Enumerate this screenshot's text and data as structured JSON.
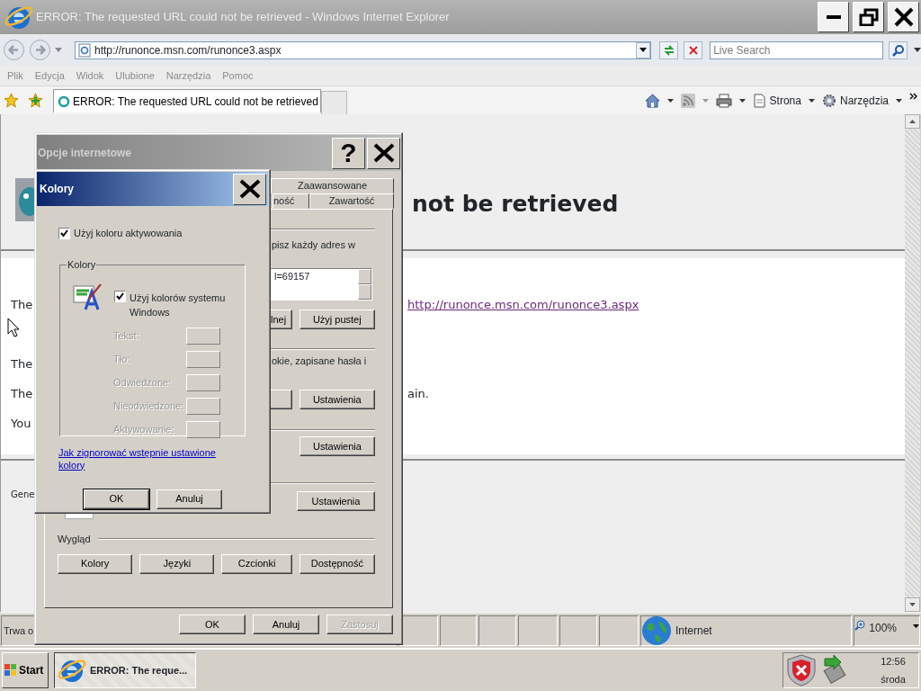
{
  "browser": {
    "title": "ERROR: The requested URL could not be retrieved - Windows Internet Explorer",
    "address": "http://runonce.msn.com/runonce3.aspx",
    "search_placeholder": "Live Search",
    "menu": [
      "Plik",
      "Edycja",
      "Widok",
      "Ulubione",
      "Narzędzia",
      "Pomoc"
    ],
    "tabs": [
      {
        "label": "ERROR: The requested URL could not be retrieved",
        "selected": true
      }
    ],
    "commands": [
      {
        "kind": "page",
        "label": "Strona"
      },
      {
        "kind": "tools",
        "label": "Narzędzia"
      }
    ]
  },
  "page": {
    "heading": "not be retrieved",
    "rows": [
      {
        "left": "The",
        "right": "http://runonce.msn.com/runonce3.aspx",
        "kind": "link"
      },
      {
        "left": "The"
      },
      {
        "left": "The",
        "right": "ain.",
        "kind": "text"
      },
      {
        "left": "You"
      }
    ],
    "footer": "Gene"
  },
  "status_bar": {
    "text": "Trwa o",
    "zone": "Internet",
    "zoom": "100%"
  },
  "options_dialog": {
    "title": "Opcje internetowe",
    "help": "?",
    "tab_rows": [
      [
        {
          "label": "Zaawansowane",
          "selected": false
        }
      ],
      [
        {
          "label": "ność",
          "selected": false
        },
        {
          "label": "Zawartość",
          "selected": false
        }
      ]
    ],
    "home": {
      "text": "pisz każdy adres w",
      "value": "l=69157",
      "buttons": [
        "lnej",
        "Użyj pustej"
      ]
    },
    "history": {
      "text": "okie, zapisane hasła i",
      "buttons": [
        "Ustawienia"
      ]
    },
    "search": {
      "buttons": [
        "Ustawienia"
      ]
    },
    "tabs_section": {
      "buttons": [
        "Ustawienia"
      ]
    },
    "appearance": {
      "label": "Wygląd",
      "buttons": [
        "Kolory",
        "Języki",
        "Czcionki",
        "Dostępność"
      ]
    },
    "footer": [
      {
        "label": "OK",
        "disabled": false
      },
      {
        "label": "Anuluj",
        "disabled": false
      },
      {
        "label": "Zastosuj",
        "disabled": true
      }
    ]
  },
  "colors_dialog": {
    "title": "Kolory",
    "hover_checkbox": {
      "label": "Użyj koloru aktywowania",
      "checked": true
    },
    "group": "Kolory",
    "system_checkbox": {
      "label": "Użyj kolorów systemu Windows",
      "checked": true
    },
    "swatches": [
      {
        "label": "Tekst:",
        "disabled": true
      },
      {
        "label": "Tło:",
        "disabled": true
      },
      {
        "label": "Odwiedzone:",
        "disabled": true
      },
      {
        "label": "Nieodwiedzone:",
        "disabled": true
      },
      {
        "label": "Aktywowanie:",
        "disabled": true
      }
    ],
    "link": "Jak zignorować wstępnie ustawione kolory",
    "buttons": [
      {
        "label": "OK",
        "default": true
      },
      {
        "label": "Anuluj",
        "default": false
      }
    ]
  },
  "taskbar": {
    "start": "Start",
    "tasks": [
      {
        "label": "ERROR: The reque...",
        "selected": true
      }
    ],
    "time": "12:56",
    "day": "środa"
  }
}
